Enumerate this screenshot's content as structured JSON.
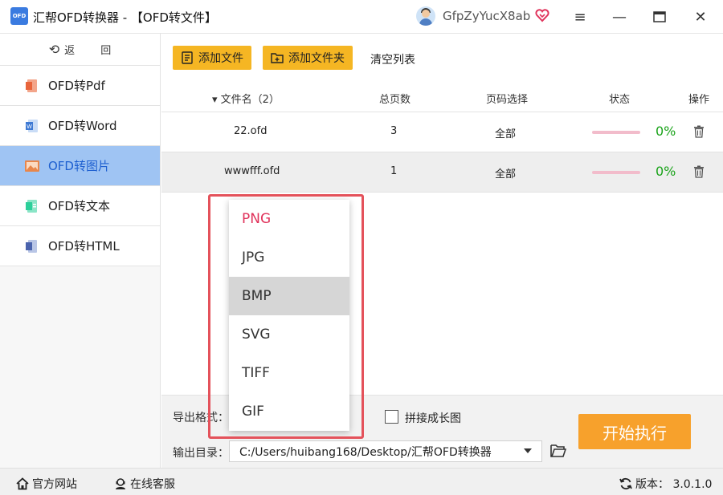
{
  "app": {
    "logo_text": "OFD",
    "title": "汇帮OFD转换器 - 【OFD转文件】",
    "username": "GfpZyYucX8ab"
  },
  "window_controls": {
    "menu_icon": "≡",
    "minimize_icon": "—",
    "maximize_icon": "▢",
    "close_icon": "✕"
  },
  "sidebar": {
    "back_label": "返 回",
    "items": [
      {
        "label": "OFD转Pdf",
        "icon": "pdf-icon",
        "active": false
      },
      {
        "label": "OFD转Word",
        "icon": "word-icon",
        "active": false
      },
      {
        "label": "OFD转图片",
        "icon": "image-icon",
        "active": true
      },
      {
        "label": "OFD转文本",
        "icon": "text-icon",
        "active": false
      },
      {
        "label": "OFD转HTML",
        "icon": "html-icon",
        "active": false
      }
    ]
  },
  "toolbar": {
    "add_file": "添加文件",
    "add_folder": "添加文件夹",
    "clear_list": "清空列表"
  },
  "table": {
    "headers": {
      "filename": "▾ 文件名（2）",
      "pages": "总页数",
      "page_select": "页码选择",
      "status": "状态",
      "action": "操作"
    },
    "rows": [
      {
        "filename": "22.ofd",
        "pages": "3",
        "page_select": "全部",
        "progress": 0,
        "percent": "0%"
      },
      {
        "filename": "wwwfff.ofd",
        "pages": "1",
        "page_select": "全部",
        "progress": 0,
        "percent": "0%"
      }
    ]
  },
  "settings": {
    "format_label": "导出格式：",
    "merge_label": "拼接成长图",
    "merge_checked": false,
    "outdir_label": "输出目录：",
    "outdir_value": "C:/Users/huibang168/Desktop/汇帮OFD转换器",
    "start_button": "开始执行"
  },
  "format_dropdown": {
    "options": [
      "PNG",
      "JPG",
      "BMP",
      "SVG",
      "TIFF",
      "GIF"
    ],
    "selected": "PNG",
    "hovered": "BMP"
  },
  "statusbar": {
    "website": "官方网站",
    "support": "在线客服",
    "version": "版本： 3.0.1.0"
  },
  "colors": {
    "accent_yellow": "#f5b623",
    "start_orange": "#f7a12c",
    "active_nav_bg": "#9fc4f3",
    "selected_option": "#e0335b",
    "percent_green": "#1aa31a",
    "highlight_red": "#e4525b"
  }
}
